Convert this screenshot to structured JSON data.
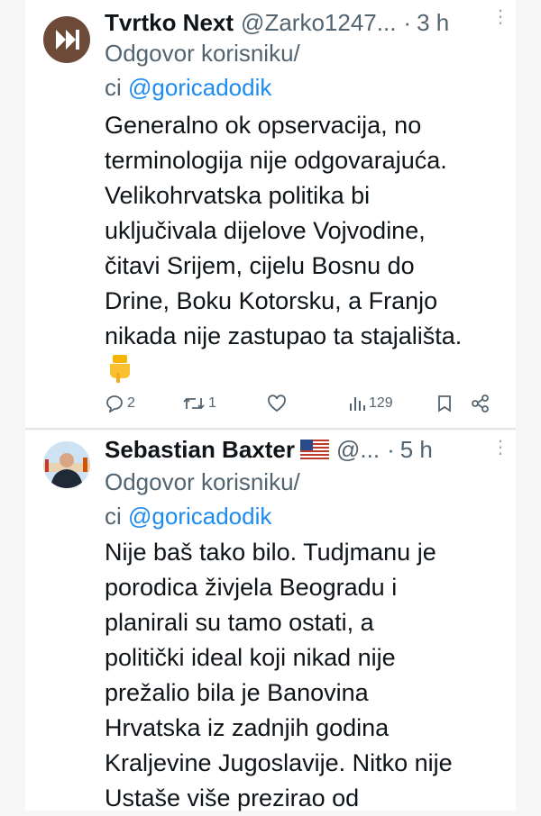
{
  "tweets": [
    {
      "name": "Tvrtko Next",
      "handle": "@Zarko1247...",
      "dot": "·",
      "time": "3 h",
      "more": "⋮",
      "reply_prefix": "Odgovor korisniku/",
      "reply_ci": "ci ",
      "reply_handle": "@goricadodik",
      "text": "Generalno ok opservacija, no\nterminologija nije odgovarajuća.\nVelikohrvatska politika bi\nuključivala dijelove Vojvodine,\nčitavi Srijem, cijelu Bosnu do\nDrine, Boku Kotorsku, a Franjo\nnikada nije zastupao ta stajališta.",
      "emoji": "backhand-index-pointing-down",
      "replies": "2",
      "retweets": "1",
      "views": "129"
    },
    {
      "name": "Sebastian Baxter",
      "flag": "us-flag",
      "handle": "@...",
      "dot": "·",
      "time": "5 h",
      "more": "⋮",
      "reply_prefix": "Odgovor korisniku/",
      "reply_ci": "ci ",
      "reply_handle": "@goricadodik",
      "text": "Nije baš tako bilo. Tudjmanu je\nporodica živjela  Beogradu i\nplanirali su tamo ostati, a\npolitički ideal koji nikad nije\nprežalio bila je Banovina\nHrvatska iz zadnjih godina\nKraljevine Jugoslavije. Nitko nije\nUstaše više prezirao od"
    }
  ],
  "colors": {
    "text": "#0f1419",
    "secondary": "#536471",
    "link": "#1d8bf0",
    "background": "#f6f6f6"
  }
}
